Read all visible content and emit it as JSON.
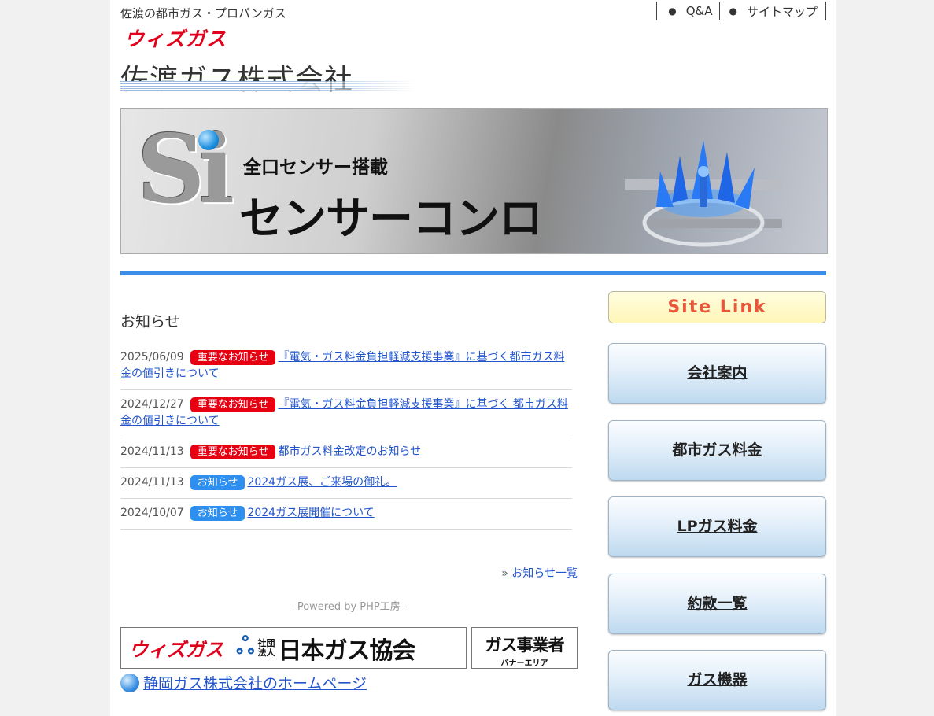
{
  "header": {
    "tagline": "佐渡の都市ガス・プロパンガス",
    "nav": [
      {
        "label": "Q&A"
      },
      {
        "label": "サイトマップ"
      }
    ],
    "brand_logo": "ウィズガス",
    "company_name": "佐渡ガス株式会社"
  },
  "hero": {
    "logo_text": "Si",
    "sub_text": "全口センサー搭載",
    "main_text": "センサーコンロ"
  },
  "news": {
    "heading": "お知らせ",
    "items": [
      {
        "date": "2025/06/09",
        "badge": "重要なお知らせ",
        "badge_type": "important",
        "title": "『電気・ガス料金負担軽減支援事業』に基づく都市ガス料金の値引きについて"
      },
      {
        "date": "2024/12/27",
        "badge": "重要なお知らせ",
        "badge_type": "important",
        "title": "『電気・ガス料金負担軽減支援事業』に基づく 都市ガス料金の値引きについて"
      },
      {
        "date": "2024/11/13",
        "badge": "重要なお知らせ",
        "badge_type": "important",
        "title": "都市ガス料金改定のお知らせ"
      },
      {
        "date": "2024/11/13",
        "badge": "お知らせ",
        "badge_type": "info",
        "title": "2024ガス展、ご来場の御礼。"
      },
      {
        "date": "2024/10/07",
        "badge": "お知らせ",
        "badge_type": "info",
        "title": "2024ガス展開催について"
      }
    ],
    "more_prefix": "»",
    "more_label": "お知らせ一覧",
    "powered_by": "- Powered by PHP工房 -"
  },
  "banners": {
    "gas_assoc": {
      "wiz": "ウィズガス",
      "mark": "ஃ",
      "small": "社団法人",
      "name": "日本ガス協会"
    },
    "gas_biz": {
      "big": "ガス事業者",
      "small": "バナーエリア"
    },
    "shizuoka_link": "静岡ガス株式会社のホームページ"
  },
  "sidebar": {
    "site_link": "Site Link",
    "buttons": [
      {
        "label": "会社案内"
      },
      {
        "label": "都市ガス料金"
      },
      {
        "label": "LPガス料金"
      },
      {
        "label": "約款一覧"
      },
      {
        "label": "ガス機器"
      }
    ]
  },
  "colors": {
    "accent_blue": "#3d8ee9",
    "badge_important": "#e60012",
    "badge_info": "#2d8ff0",
    "link": "#2255cc",
    "brand_red": "#e0001b"
  }
}
